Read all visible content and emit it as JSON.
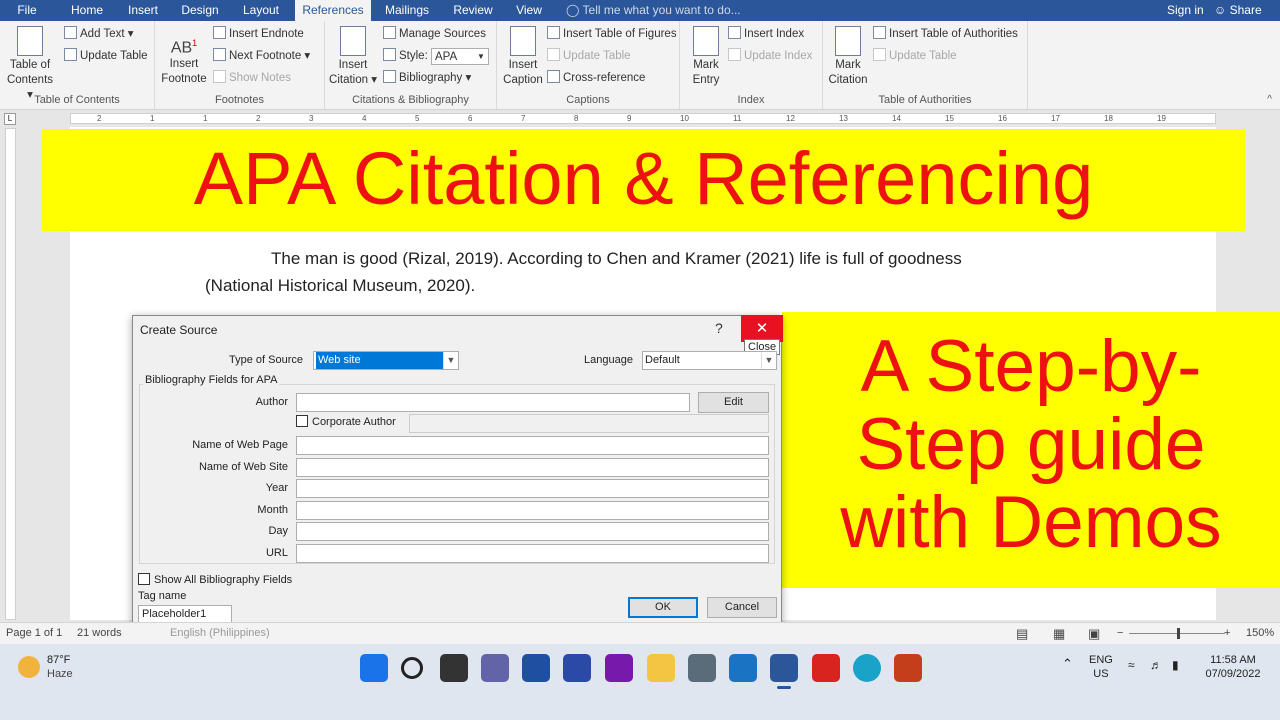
{
  "menubar": {
    "tabs": [
      "File",
      "Home",
      "Insert",
      "Design",
      "Layout",
      "References",
      "Mailings",
      "Review",
      "View"
    ],
    "tell_me": "Tell me what you want to do...",
    "sign_in": "Sign in",
    "share": "Share"
  },
  "ribbon": {
    "toc": {
      "big": "Table of Contents",
      "add_text": "Add Text",
      "update_table": "Update Table",
      "label": "Table of Contents"
    },
    "footnotes": {
      "insert_footnote": "Insert Footnote",
      "insert_endnote": "Insert Endnote",
      "next_footnote": "Next Footnote",
      "show_notes": "Show Notes",
      "label": "Footnotes"
    },
    "citations": {
      "insert_citation": "Insert Citation",
      "manage_sources": "Manage Sources",
      "style_label": "Style:",
      "style_value": "APA",
      "bibliography": "Bibliography",
      "label": "Citations & Bibliography"
    },
    "captions": {
      "insert_caption": "Insert Caption",
      "insert_tof": "Insert Table of Figures",
      "update_table": "Update Table",
      "cross_reference": "Cross-reference",
      "label": "Captions"
    },
    "index": {
      "mark_entry": "Mark Entry",
      "insert_index": "Insert Index",
      "update_index": "Update Index",
      "label": "Index"
    },
    "toa": {
      "mark_citation": "Mark Citation",
      "insert_toa": "Insert Table of Authorities",
      "update_table": "Update Table",
      "label": "Table of Authorities"
    }
  },
  "ruler": {
    "marks": [
      "2",
      "1",
      "1",
      "2",
      "3",
      "4",
      "5",
      "6",
      "7",
      "8",
      "9",
      "10",
      "11",
      "12",
      "13",
      "14",
      "15",
      "16",
      "17",
      "18",
      "19"
    ]
  },
  "document": {
    "line1": "The man is good (Rizal, 2019). According to Chen and Kramer (2021) life is full of goodness",
    "line2": "(National Historical Museum, 2020)."
  },
  "overlay": {
    "banner_top": "APA Citation & Referencing",
    "banner_right_lines": [
      "A Step-by-",
      "Step guide",
      "with Demos"
    ]
  },
  "dialog": {
    "title": "Create Source",
    "help": "?",
    "close_tooltip": "Close",
    "type_label": "Type of Source",
    "type_value": "Web site",
    "language_label": "Language",
    "language_value": "Default",
    "group_label": "Bibliography Fields for APA",
    "author_label": "Author",
    "edit_button": "Edit",
    "corporate_author": "Corporate Author",
    "fields": [
      {
        "label": "Name of Web Page",
        "value": ""
      },
      {
        "label": "Name of Web Site",
        "value": ""
      },
      {
        "label": "Year",
        "value": ""
      },
      {
        "label": "Month",
        "value": ""
      },
      {
        "label": "Day",
        "value": ""
      },
      {
        "label": "URL",
        "value": ""
      }
    ],
    "show_all": "Show All Bibliography Fields",
    "tag_label": "Tag name",
    "tag_value": "Placeholder1",
    "ok": "OK",
    "cancel": "Cancel"
  },
  "statusbar": {
    "page": "Page 1 of 1",
    "words": "21 words",
    "language": "English (Philippines)",
    "zoom": "150%"
  },
  "taskbar": {
    "weather_temp": "87°F",
    "weather_text": "Haze",
    "lang_top": "ENG",
    "lang_bottom": "US",
    "time": "11:58 AM",
    "date": "07/09/2022"
  },
  "colors": {
    "word_blue": "#2b579a",
    "banner_yellow": "#ffff00",
    "banner_red": "#ee1111",
    "close_red": "#e81123"
  }
}
